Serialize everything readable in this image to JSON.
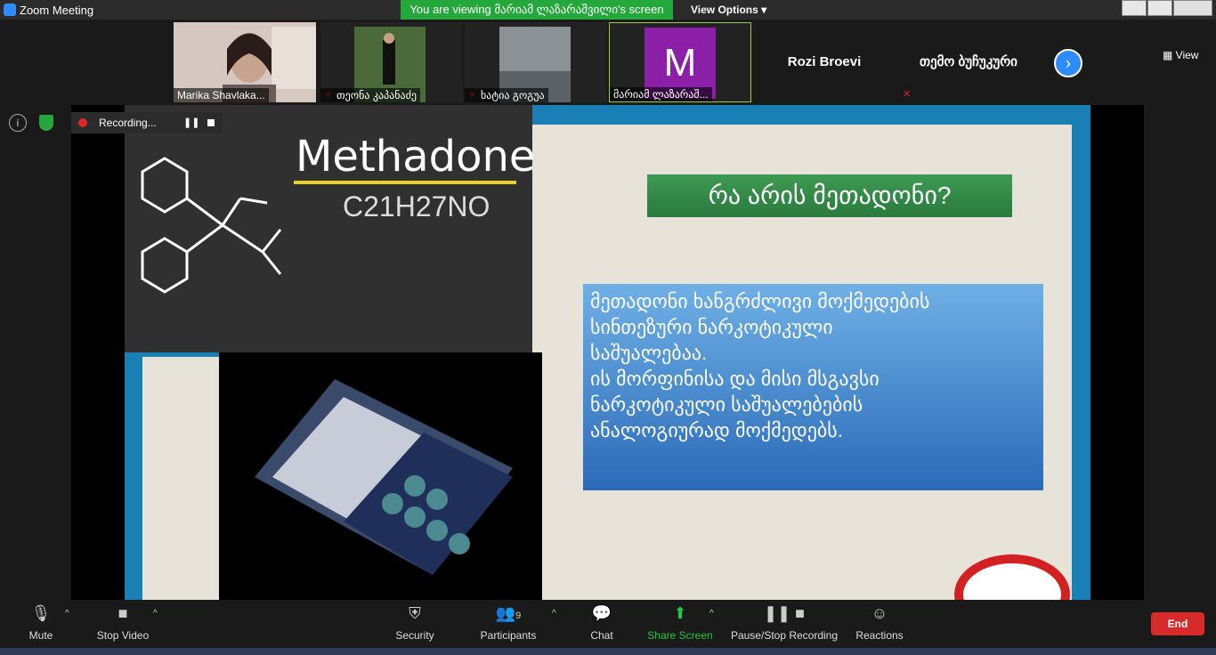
{
  "window": {
    "title": "Zoom Meeting"
  },
  "banner": {
    "viewing": "You are viewing მარიამ ლაზარაშვილი's screen",
    "view_options": "View Options"
  },
  "participants": [
    {
      "name": "Marika Shavlaka...",
      "muted": false,
      "kind": "video"
    },
    {
      "name": "თეონა კაპანაძე",
      "muted": true,
      "kind": "photo"
    },
    {
      "name": "ხატია გოგუა",
      "muted": true,
      "kind": "photo"
    },
    {
      "name": "მარიამ ლაზარაშ...",
      "muted": false,
      "kind": "avatar",
      "avatar_letter": "M",
      "avatar_color": "#8b1fa8"
    },
    {
      "name": "Rozi Broevi",
      "muted": false,
      "kind": "name-only"
    },
    {
      "name": "თემო ბუჩუკური",
      "muted": true,
      "kind": "name-only"
    }
  ],
  "strip": {
    "next_icon": "chevron-right-icon",
    "view_label": "View"
  },
  "recording": {
    "label": "Recording..."
  },
  "slide": {
    "heading": "Methadone",
    "formula": "C21H27NO",
    "title": "რა არის მეთადონი?",
    "body": "მეთადონი ხანგრძლივი  მოქმედების\nსინთეზური ნარკოტიკული\nსაშუალებაა.\n ის მორფინისა და მისი მსგავსი\nნარკოტიკული საშუალებების\nანალოგიურად მოქმედებს."
  },
  "toolbar": {
    "mute": "Mute",
    "stop_video": "Stop Video",
    "security": "Security",
    "participants": "Participants",
    "participants_count": "9",
    "chat": "Chat",
    "share_screen": "Share Screen",
    "recording": "Pause/Stop Recording",
    "reactions": "Reactions",
    "end": "End"
  },
  "colors": {
    "share_green": "#25c840",
    "end_red": "#d72b2b",
    "banner_green": "#25a83b"
  }
}
